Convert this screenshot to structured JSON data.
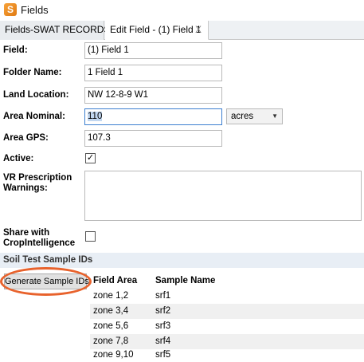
{
  "window": {
    "title": "Fields",
    "icon": "app-logo-icon"
  },
  "tabs": [
    {
      "label": "Fields-SWAT RECORDS SK",
      "active": false
    },
    {
      "label": "Edit Field - (1) Field 1",
      "active": true,
      "close_label": "X"
    }
  ],
  "form": {
    "field": {
      "label": "Field:",
      "value": "(1) Field 1"
    },
    "folder_name": {
      "label": "Folder Name:",
      "value": "1 Field 1"
    },
    "land_location": {
      "label": "Land Location:",
      "value": "NW 12-8-9 W1"
    },
    "area_nominal": {
      "label": "Area Nominal:",
      "value": "110",
      "unit": "acres"
    },
    "area_gps": {
      "label": "Area GPS:",
      "value": "107.3"
    },
    "active": {
      "label": "Active:",
      "checked": true,
      "check_glyph": "✓"
    },
    "vr_warnings": {
      "label_line1": "VR Prescription",
      "label_line2": "Warnings:",
      "value": ""
    },
    "share": {
      "label_line1": "Share with",
      "label_line2": "CropIntelligence",
      "checked": false
    }
  },
  "soil_test": {
    "section_title": "Soil Test Sample IDs",
    "generate_button": "Generate Sample IDs",
    "columns": [
      "Field Area",
      "Sample Name"
    ],
    "rows": [
      [
        "zone 1,2",
        "srf1"
      ],
      [
        "zone 3,4",
        "srf2"
      ],
      [
        "zone 5,6",
        "srf3"
      ],
      [
        "zone 7,8",
        "srf4"
      ],
      [
        "zone 9,10",
        "srf5"
      ]
    ]
  },
  "colors": {
    "highlight_ring": "#e8622c",
    "focus_border": "#3c7fd0",
    "selection": "#c2d7f0"
  }
}
